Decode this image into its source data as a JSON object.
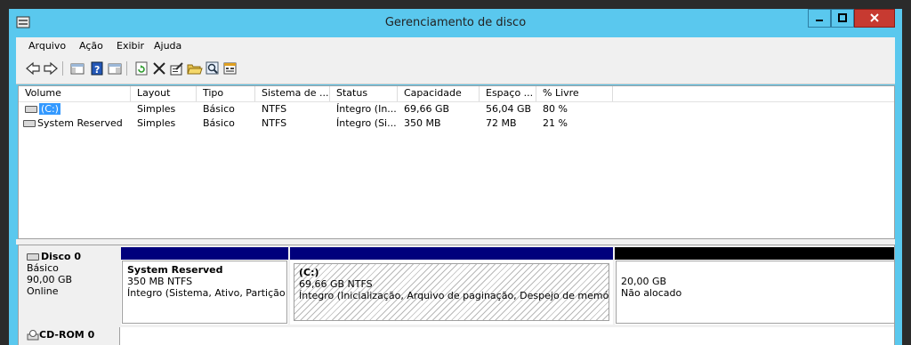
{
  "window": {
    "title": "Gerenciamento de disco",
    "controls": {
      "minimize": "–",
      "maximize": "□",
      "close": "x"
    }
  },
  "menu": [
    "Arquivo",
    "Ação",
    "Exibir",
    "Ajuda"
  ],
  "toolbar": [
    "back-icon",
    "forward-icon",
    "console-tree-icon",
    "help-icon",
    "properties-pane-icon",
    "refresh-icon",
    "delete-icon",
    "properties-icon",
    "open-folder-icon",
    "explore-icon",
    "help-topics-icon"
  ],
  "volume_list": {
    "columns": [
      "Volume",
      "Layout",
      "Tipo",
      "Sistema de ...",
      "Status",
      "Capacidade",
      "Espaço ...",
      "% Livre"
    ],
    "rows": [
      {
        "volume": "(C:)",
        "layout": "Simples",
        "tipo": "Básico",
        "sistema": "NTFS",
        "status": "Íntegro (In...",
        "capacidade": "69,66 GB",
        "espaco": "56,04 GB",
        "livre": "80 %",
        "selected": true
      },
      {
        "volume": "System Reserved",
        "layout": "Simples",
        "tipo": "Básico",
        "sistema": "NTFS",
        "status": "Íntegro (Si...",
        "capacidade": "350 MB",
        "espaco": "72 MB",
        "livre": "21 %",
        "selected": false
      }
    ]
  },
  "disk0": {
    "name": "Disco 0",
    "type": "Básico",
    "size": "90,00 GB",
    "state": "Online",
    "partitions": [
      {
        "name": "System Reserved",
        "size": "350 MB NTFS",
        "status": "Íntegro (Sistema, Ativo, Partição p",
        "bar_color": "#00007c"
      },
      {
        "name": "(C:)",
        "size": "69,66 GB NTFS",
        "status": "Íntegro (Inicialização, Arquivo de paginação, Despejo de memória, P",
        "bar_color": "#00007c"
      },
      {
        "name": "",
        "size": "20,00 GB",
        "status": "Não alocado",
        "bar_color": "#000000"
      }
    ]
  },
  "cdrom": {
    "name": "CD-ROM 0"
  },
  "colors": {
    "titlebar": "#5ac8ee",
    "close_button": "#c73a31",
    "selection": "#3399ff",
    "primary_partition": "#00007c",
    "unallocated": "#000000"
  }
}
